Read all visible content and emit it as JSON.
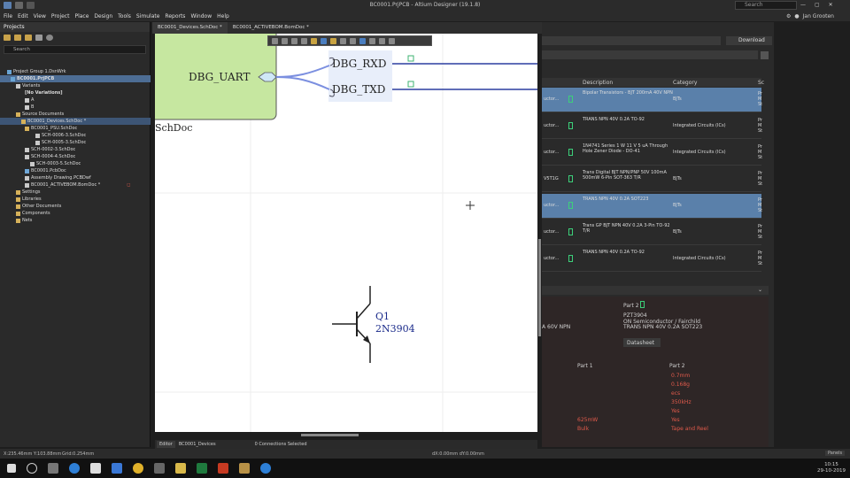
{
  "window": {
    "title": "BC0001.PrjPCB - Altium Designer (19.1.8)",
    "search": "Search",
    "user": "Jan Grooten"
  },
  "menu": [
    "File",
    "Edit",
    "View",
    "Project",
    "Place",
    "Design",
    "Tools",
    "Simulate",
    "Reports",
    "Window",
    "Help"
  ],
  "projects": {
    "title": "Projects",
    "search": "Search",
    "tree": [
      "Project Group 1.DsnWrk",
      "BC0001.PrjPCB",
      "Variants",
      "[No Variations]",
      "A",
      "B",
      "Source Documents",
      "BC0001_Devices.SchDoc *",
      "BC0001_PSU.SchDoc",
      "SCH-0006-3.SchDoc",
      "SCH-0005-3.SchDoc",
      "SCH-0002-3.SchDoc",
      "SCH-0004-4.SchDoc",
      "SCH-0003-5.SchDoc",
      "BC0001.PcbDoc",
      "Assembly Drawing.PCBDwf",
      "BC0001_ACTIVEBOM.BomDoc *",
      "Settings",
      "Libraries",
      "Other Documents",
      "Components",
      "Nets"
    ]
  },
  "tabs": [
    "BC0001_Devices.SchDoc *",
    "BC0001_ACTIVEBOM.BomDoc *"
  ],
  "schematic": {
    "sheet_label": "DBG_UART",
    "partial_label": "SchDoc",
    "ports": [
      "DBG_RXD",
      "DBG_TXD"
    ],
    "designator": "Q1",
    "part": "2N3904"
  },
  "editor": {
    "tabs": [
      "Editor",
      "BC0001_Devices"
    ],
    "connections": "0 Connections Selected"
  },
  "status": {
    "coords": "X:235.46mm Y:103.88mm",
    "grid": "Grid:0.254mm",
    "dxdy": "dX:0.00mm dY:0.00mm",
    "panels": "Panels"
  },
  "parts": {
    "download": "Download",
    "headers": [
      "Description",
      "Category",
      "Sc"
    ],
    "rows": [
      {
        "pn": "uctor...",
        "desc": "Bipolar Transistors - BJT 200mA 40V NPN",
        "cat": "BJTs",
        "side": "Pr M St",
        "selected": true
      },
      {
        "pn": "uctor...",
        "desc": "TRANS NPN 40V 0.2A TO-92",
        "cat": "Integrated Circuits (ICs)",
        "side": "Pr M St",
        "selected": false
      },
      {
        "pn": "uctor...",
        "desc": "1N4741 Series 1 W 11 V 5 uA Through Hole Zener Diode - DO-41",
        "cat": "Integrated Circuits (ICs)",
        "side": "Pr M St",
        "selected": false
      },
      {
        "pn": "V5T1G",
        "desc": "Trans Digital BJT NPN/PNP 50V 100mA 500mW 6-Pin SOT-363 T/R",
        "cat": "BJTs",
        "side": "Pr M St",
        "selected": false
      },
      {
        "pn": "uctor...",
        "desc": "TRANS NPN 40V 0.2A SOT223",
        "cat": "BJTs",
        "side": "Pr M St",
        "selected": true
      },
      {
        "pn": "uctor...",
        "desc": "Trans GP BJT NPN 40V 0.2A 3-Pin TO-92 T/R",
        "cat": "BJTs",
        "side": "Pr M St",
        "selected": false
      },
      {
        "pn": "uctor...",
        "desc": "TRANS NPN 40V 0.2A TO-92",
        "cat": "Integrated Circuits (ICs)",
        "side": "Pr M St",
        "selected": false
      }
    ]
  },
  "compare": {
    "part2_label": "Part 2",
    "part2_num": "PZT3904",
    "manufacturer": "ON Semiconductor / Fairchild",
    "part2_desc": "TRANS NPN 40V 0.2A SOT223",
    "left_desc": "A 60V NPN",
    "datasheet": "Datasheet",
    "cols": [
      "Part 1",
      "Part 2"
    ],
    "part2_vals": [
      "0.7mm",
      "0.168g",
      "ecs",
      "350kHz",
      "Yes",
      "Yes",
      "Tape and Reel"
    ],
    "part1_vals": [
      "625mW",
      "Bulk"
    ]
  },
  "clock": {
    "time": "10:15",
    "date": "29-10-2019"
  }
}
